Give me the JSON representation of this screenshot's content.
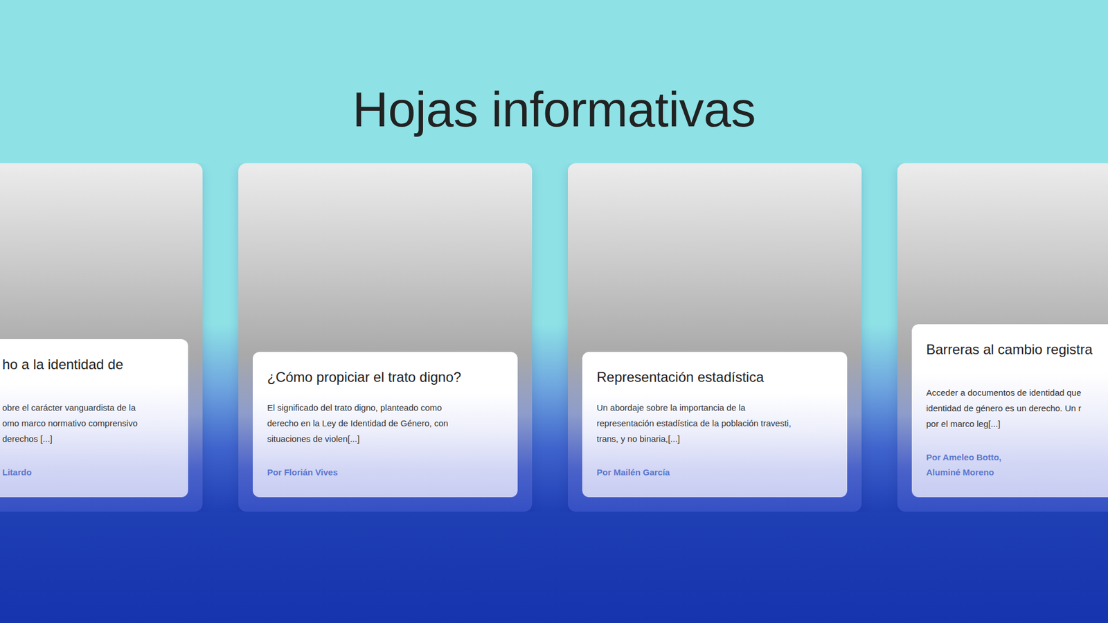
{
  "section": {
    "title": "Hojas informativas"
  },
  "cards": [
    {
      "title": "ho a la identidad de",
      "lines": [
        "obre el carácter vanguardista de la",
        "omo marco normativo comprensivo",
        "derechos [...]"
      ],
      "authors": [
        "Litardo"
      ]
    },
    {
      "title": "¿Cómo propiciar el trato digno?",
      "lines": [
        "El significado del trato digno, planteado como",
        "derecho en la Ley de Identidad de Género, con",
        "situaciones de violen[...]"
      ],
      "authors": [
        "Por Florián Vives"
      ]
    },
    {
      "title": "Representación estadística",
      "lines": [
        "Un abordaje sobre la importancia de la",
        "representación estadística de la población travesti,",
        "trans, y no binaria,[...]"
      ],
      "authors": [
        "Por Mailén García"
      ]
    },
    {
      "title": "Barreras al cambio registra",
      "lines": [
        "Acceder a documentos de identidad que",
        "identidad de género es un derecho. Un r",
        "por el marco leg[...]"
      ],
      "authors": [
        "Por Ameleo Botto,",
        "Aluminé Moreno"
      ]
    }
  ]
}
